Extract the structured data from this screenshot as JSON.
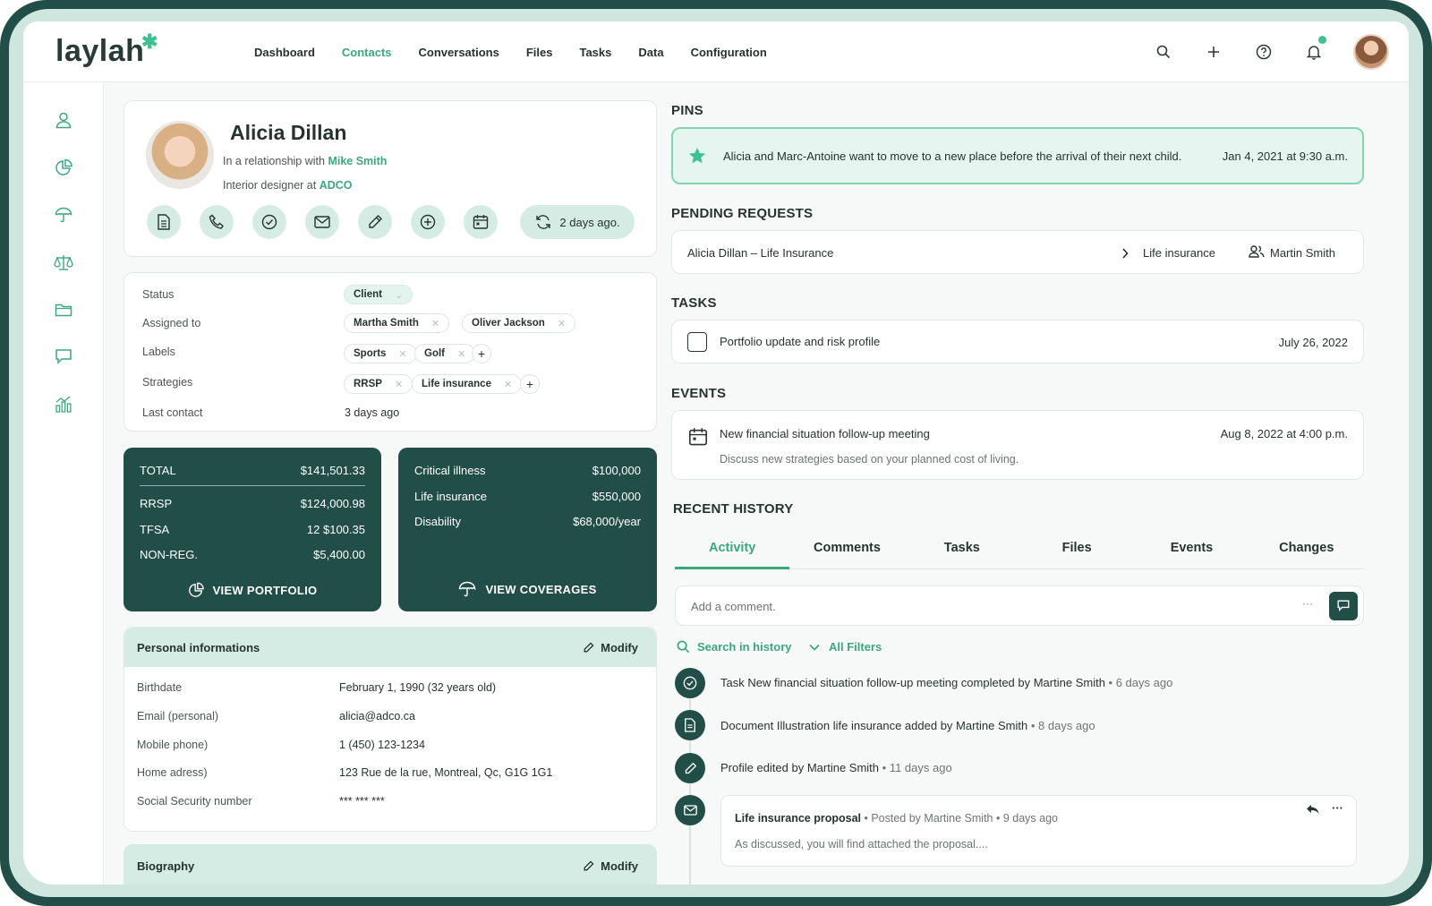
{
  "app": {
    "logo": "laylah",
    "logo_mark": "✱"
  },
  "nav": [
    "Dashboard",
    "Contacts",
    "Conversations",
    "Files",
    "Tasks",
    "Data",
    "Configuration"
  ],
  "active_nav": "Contacts",
  "sidebar_icons": [
    "user-icon",
    "pie-chart-icon",
    "umbrella-icon",
    "scale-icon",
    "folder-icon",
    "chat-icon",
    "bar-chart-icon"
  ],
  "profile": {
    "name": "Alicia Dillan",
    "relationship_prefix": "In a relationship with ",
    "relationship_name": "Mike Smith",
    "job_prefix": "Interior designer at ",
    "company": "ADCO",
    "last_update": "2 days ago."
  },
  "details": {
    "status_label": "Status",
    "status_value": "Client",
    "assigned_label": "Assigned to",
    "assigned": [
      "Martha Smith",
      "Oliver Jackson"
    ],
    "labels_label": "Labels",
    "labels": [
      "Sports",
      "Golf"
    ],
    "strategies_label": "Strategies",
    "strategies": [
      "RRSP",
      "Life insurance"
    ],
    "last_contact_label": "Last contact",
    "last_contact_value": "3 days ago"
  },
  "portfolio": {
    "total_label": "TOTAL",
    "total_value": "$141,501.33",
    "rows": [
      {
        "label": "RRSP",
        "value": "$124,000.98"
      },
      {
        "label": "TFSA",
        "value": "12 $100.35"
      },
      {
        "label": "NON-REG.",
        "value": "$5,400.00"
      }
    ],
    "button": "VIEW PORTFOLIO"
  },
  "coverages": {
    "rows": [
      {
        "label": "Critical illness",
        "value": "$100,000"
      },
      {
        "label": "Life insurance",
        "value": "$550,000"
      },
      {
        "label": "Disability",
        "value": "$68,000/year"
      }
    ],
    "button": "VIEW COVERAGES"
  },
  "personal": {
    "title": "Personal informations",
    "modify": "Modify",
    "rows": [
      {
        "label": "Birthdate",
        "value": "February 1, 1990 (32 years old)"
      },
      {
        "label": "Email (personal)",
        "value": "alicia@adco.ca"
      },
      {
        "label": "Mobile phone)",
        "value": "1 (450) 123-1234"
      },
      {
        "label": "Home adress)",
        "value": "123 Rue de la rue, Montreal, Qc, G1G 1G1"
      },
      {
        "label": "Social Security number",
        "value": "*** *** ***"
      }
    ]
  },
  "biography": {
    "title": "Biography",
    "modify": "Modify"
  },
  "pins": {
    "title": "PINS",
    "text": "Alicia and Marc-Antoine want to move to a new place before the arrival of their next child.",
    "date": "Jan 4, 2021 at 9:30 a.m."
  },
  "pending": {
    "title": "PENDING REQUESTS",
    "name": "Alicia Dillan – Life Insurance",
    "type": "Life insurance",
    "owner": "Martin Smith"
  },
  "tasks": {
    "title": "TASKS",
    "name": "Portfolio update and risk profile",
    "date": "July 26, 2022"
  },
  "events": {
    "title": "EVENTS",
    "name": "New financial situation follow-up meeting",
    "date": "Aug 8, 2022 at 4:00 p.m.",
    "desc": "Discuss new strategies based on your planned cost of living."
  },
  "history": {
    "title": "RECENT HISTORY",
    "tabs": [
      "Activity",
      "Comments",
      "Tasks",
      "Files",
      "Events",
      "Changes"
    ],
    "comment_placeholder": "Add a comment.",
    "comment_more": "···",
    "search": "Search in history",
    "filters": "All Filters",
    "items": [
      {
        "text": "Task New financial situation follow-up meeting completed by Martine Smith",
        "sep": " • ",
        "ago": "6 days ago"
      },
      {
        "text": "Document Illustration life insurance added by Martine Smith",
        "sep": " • ",
        "ago": "8 days ago"
      },
      {
        "text": "Profile edited by Martine Smith",
        "sep": " • ",
        "ago": "11 days ago"
      }
    ],
    "message": {
      "title": "Life insurance proposal",
      "meta": " • Posted by Martine Smith • 9 days ago",
      "body": "As discussed, you will find attached the proposal....",
      "more": "···"
    }
  },
  "colors": {
    "accent": "#3aa87f",
    "dark": "#214e46",
    "mint": "#d4ece4"
  }
}
